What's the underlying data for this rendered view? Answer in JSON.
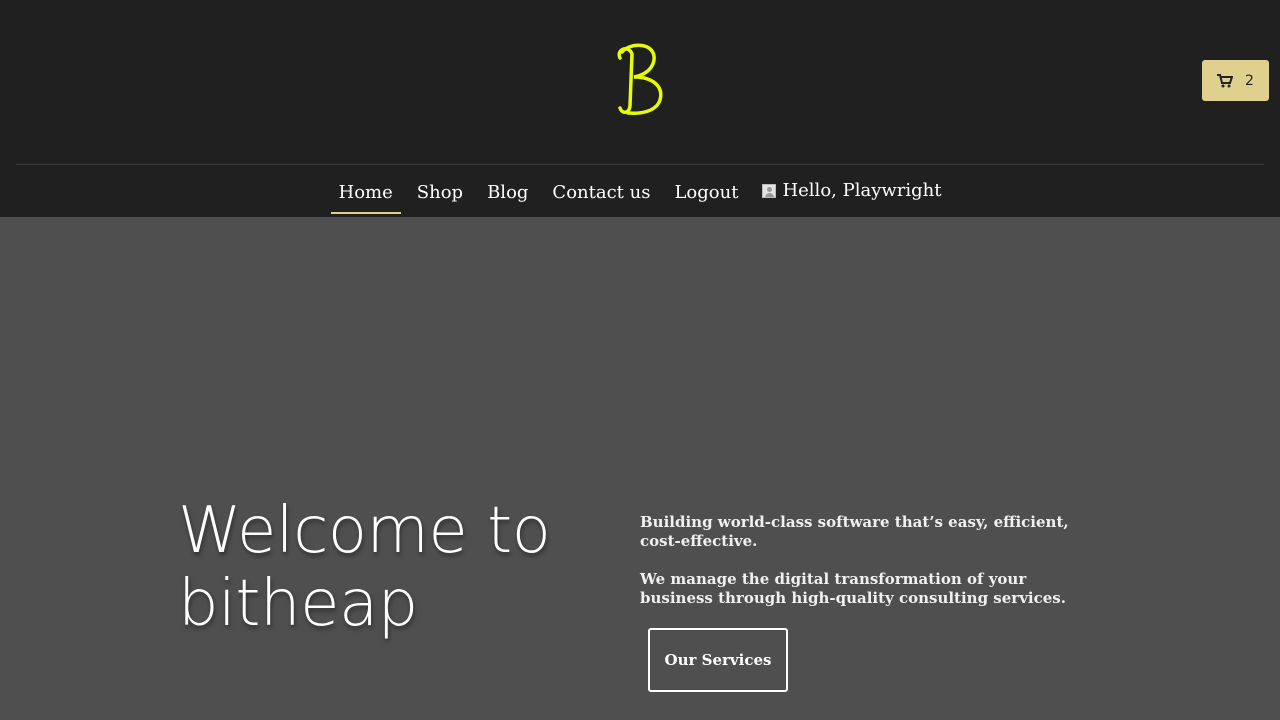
{
  "brand": {
    "logo_icon": "script-b-logo-icon",
    "logo_color": "#e6ff00"
  },
  "cart": {
    "icon": "shopping-cart-icon",
    "count": "2",
    "color": "#e0d08e"
  },
  "nav": {
    "items": [
      {
        "label": "Home",
        "active": true
      },
      {
        "label": "Shop",
        "active": false
      },
      {
        "label": "Blog",
        "active": false
      },
      {
        "label": "Contact us",
        "active": false
      },
      {
        "label": "Logout",
        "active": false
      }
    ],
    "user_label": "Hello, Playwright",
    "user_icon": "avatar-icon"
  },
  "hero": {
    "title": "Welcome to bitheap",
    "tagline": "Building world-class software that’s easy, efficient, cost-effective.",
    "description": "We manage the digital transformation of your business through high-quality consulting services.",
    "button_label": "Our Services"
  }
}
